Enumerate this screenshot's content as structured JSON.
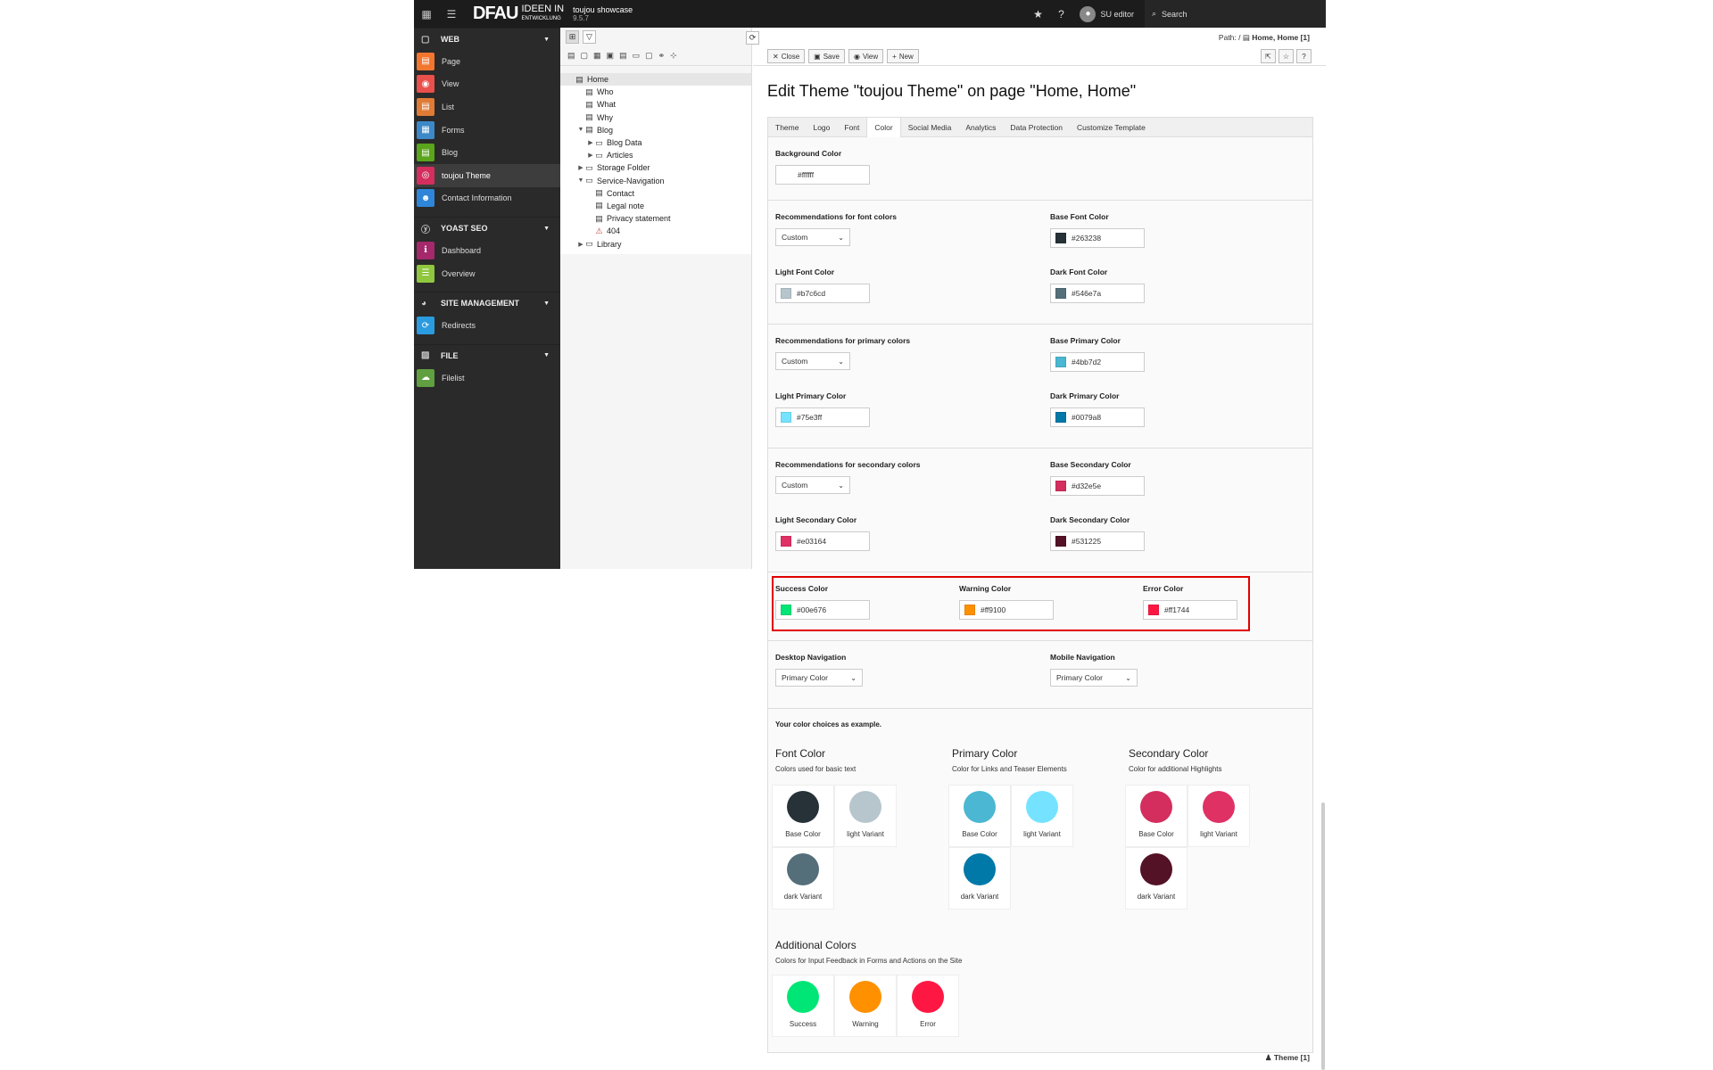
{
  "topbar": {
    "logo_main": "DFAU",
    "logo_sub1": "IDEEN IN",
    "logo_sub2": "ENTWICKLUNG",
    "site_name": "toujou showcase",
    "version": "9.5.7",
    "user": "SU editor",
    "search_label": "Search"
  },
  "sidebar": {
    "groups": [
      {
        "label": "WEB",
        "items": [
          {
            "label": "Page",
            "color": "#f2762e"
          },
          {
            "label": "View",
            "color": "#e8504b"
          },
          {
            "label": "List",
            "color": "#e07b36"
          },
          {
            "label": "Forms",
            "color": "#3d88c8"
          },
          {
            "label": "Blog",
            "color": "#5aa51b"
          },
          {
            "label": "toujou Theme",
            "color": "#d32e5e"
          },
          {
            "label": "Contact Information",
            "color": "#2f86d8"
          }
        ]
      },
      {
        "label": "YOAST SEO",
        "items": [
          {
            "label": "Dashboard",
            "color": "#a4286a"
          },
          {
            "label": "Overview",
            "color": "#8fc73e"
          }
        ]
      },
      {
        "label": "SITE MANAGEMENT",
        "items": [
          {
            "label": "Redirects",
            "color": "#2b9be0"
          }
        ]
      },
      {
        "label": "FILE",
        "items": [
          {
            "label": "Filelist",
            "color": "#60a040"
          }
        ]
      }
    ]
  },
  "tree": {
    "nodes": [
      {
        "label": "Home",
        "level": 0,
        "toggle": ""
      },
      {
        "label": "Who",
        "level": 1,
        "toggle": ""
      },
      {
        "label": "What",
        "level": 1,
        "toggle": ""
      },
      {
        "label": "Why",
        "level": 1,
        "toggle": ""
      },
      {
        "label": "Blog",
        "level": 1,
        "toggle": "▼"
      },
      {
        "label": "Blog Data",
        "level": 2,
        "toggle": "▶"
      },
      {
        "label": "Articles",
        "level": 2,
        "toggle": "▶"
      },
      {
        "label": "Storage Folder",
        "level": 1,
        "toggle": "▶"
      },
      {
        "label": "Service-Navigation",
        "level": 1,
        "toggle": "▼"
      },
      {
        "label": "Contact",
        "level": 2,
        "toggle": ""
      },
      {
        "label": "Legal note",
        "level": 2,
        "toggle": ""
      },
      {
        "label": "Privacy statement",
        "level": 2,
        "toggle": ""
      },
      {
        "label": "404",
        "level": 2,
        "toggle": ""
      },
      {
        "label": "Library",
        "level": 1,
        "toggle": "▶"
      }
    ]
  },
  "docheader": {
    "path_prefix": "Path: /",
    "path_value": "Home, Home [1]",
    "close": "Close",
    "save": "Save",
    "view": "View",
    "new": "New"
  },
  "page_title": "Edit Theme \"toujou Theme\" on page \"Home, Home\"",
  "tabs": [
    "Theme",
    "Logo",
    "Font",
    "Color",
    "Social Media",
    "Analytics",
    "Data Protection",
    "Customize Template"
  ],
  "form": {
    "background": {
      "label": "Background Color",
      "value": "#ffffff"
    },
    "font_reco": {
      "label": "Recommendations for font colors",
      "value": "Custom"
    },
    "base_font": {
      "label": "Base Font Color",
      "value": "#263238"
    },
    "light_font": {
      "label": "Light Font Color",
      "value": "#b7c6cd"
    },
    "dark_font": {
      "label": "Dark Font Color",
      "value": "#546e7a"
    },
    "primary_reco": {
      "label": "Recommendations for primary colors",
      "value": "Custom"
    },
    "base_primary": {
      "label": "Base Primary Color",
      "value": "#4bb7d2"
    },
    "light_primary": {
      "label": "Light Primary Color",
      "value": "#75e3ff"
    },
    "dark_primary": {
      "label": "Dark Primary Color",
      "value": "#0079a8"
    },
    "secondary_reco": {
      "label": "Recommendations for secondary colors",
      "value": "Custom"
    },
    "base_secondary": {
      "label": "Base Secondary Color",
      "value": "#d32e5e"
    },
    "light_secondary": {
      "label": "Light Secondary Color",
      "value": "#e03164"
    },
    "dark_secondary": {
      "label": "Dark Secondary Color",
      "value": "#531225"
    },
    "success": {
      "label": "Success Color",
      "value": "#00e676"
    },
    "warning": {
      "label": "Warning Color",
      "value": "#ff9100"
    },
    "error": {
      "label": "Error Color",
      "value": "#ff1744"
    },
    "desktop_nav": {
      "label": "Desktop Navigation",
      "value": "Primary Color"
    },
    "mobile_nav": {
      "label": "Mobile Navigation",
      "value": "Primary Color"
    }
  },
  "preview": {
    "heading": "Your color choices as example.",
    "font": {
      "title": "Font Color",
      "sub": "Colors used for basic text",
      "base": "Base Color",
      "light": "light Variant",
      "dark": "dark Variant"
    },
    "primary": {
      "title": "Primary Color",
      "sub": "Color for Links and Teaser Elements",
      "base": "Base Color",
      "light": "light Variant",
      "dark": "dark Variant"
    },
    "secondary": {
      "title": "Secondary Color",
      "sub": "Color for additional Highlights",
      "base": "Base Color",
      "light": "light Variant",
      "dark": "dark Variant"
    },
    "additional": {
      "title": "Additional Colors",
      "sub": "Colors for Input Feedback in Forms and Actions on the Site",
      "success": "Success",
      "warning": "Warning",
      "error": "Error"
    }
  },
  "footer": "Theme [1]"
}
